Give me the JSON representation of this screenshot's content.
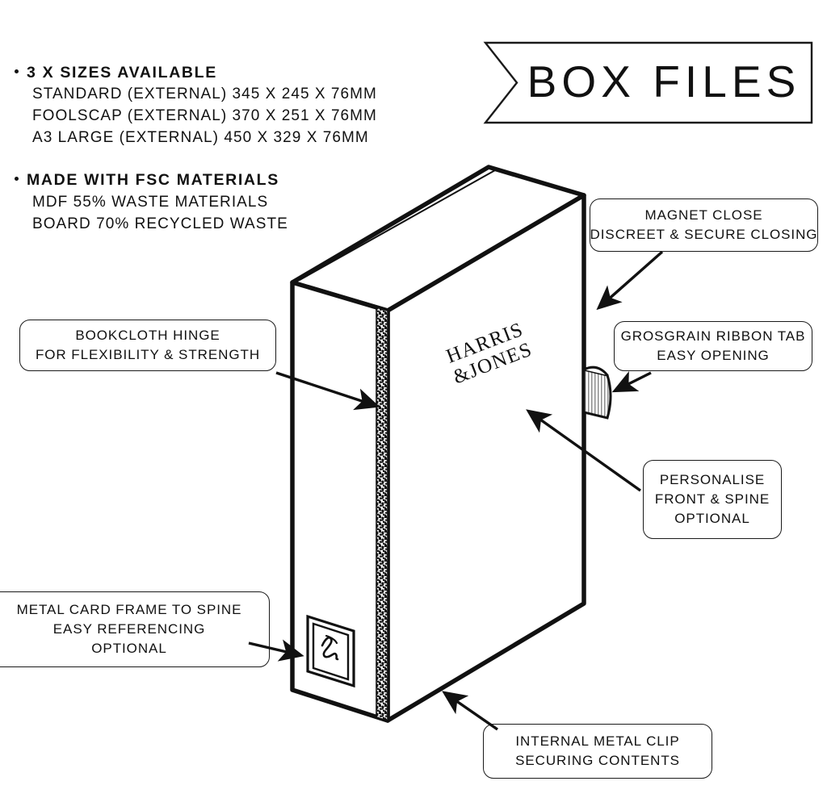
{
  "banner": {
    "title": "BOX FILES"
  },
  "specs": [
    {
      "heading": "3 X SIZES AVAILABLE",
      "lines": [
        "STANDARD (EXTERNAL) 345 X 245 X 76MM",
        "FOOLSCAP (EXTERNAL) 370 X 251 X 76MM",
        "A3 LARGE (EXTERNAL) 450 X 329 X 76MM"
      ]
    },
    {
      "heading": "MADE WITH FSC MATERIALS",
      "lines": [
        "MDF 55% WASTE MATERIALS",
        "BOARD 70% RECYCLED WASTE"
      ]
    }
  ],
  "callouts": {
    "magnet": {
      "line1": "MAGNET CLOSE",
      "line2": "DISCREET & SECURE CLOSING"
    },
    "ribbon": {
      "line1": "GROSGRAIN RIBBON TAB",
      "line2": "EASY OPENING"
    },
    "personalise": {
      "line1": "PERSONALISE",
      "line2": "FRONT & SPINE",
      "line3": "OPTIONAL"
    },
    "bookcloth": {
      "line1": "BOOKCLOTH HINGE",
      "line2": "FOR FLEXIBILITY & STRENGTH"
    },
    "metalcard": {
      "line1": "METAL CARD FRAME TO SPINE",
      "line2": "EASY REFERENCING",
      "line3": "OPTIONAL"
    },
    "internal": {
      "line1": "INTERNAL METAL CLIP",
      "line2": "SECURING CONTENTS"
    }
  },
  "product": {
    "brand_line_1": "HARRIS",
    "brand_line_2": "&JONES"
  },
  "colors": {
    "ink": "#111111",
    "paper": "#ffffff",
    "outline": "#1a1a1a"
  }
}
